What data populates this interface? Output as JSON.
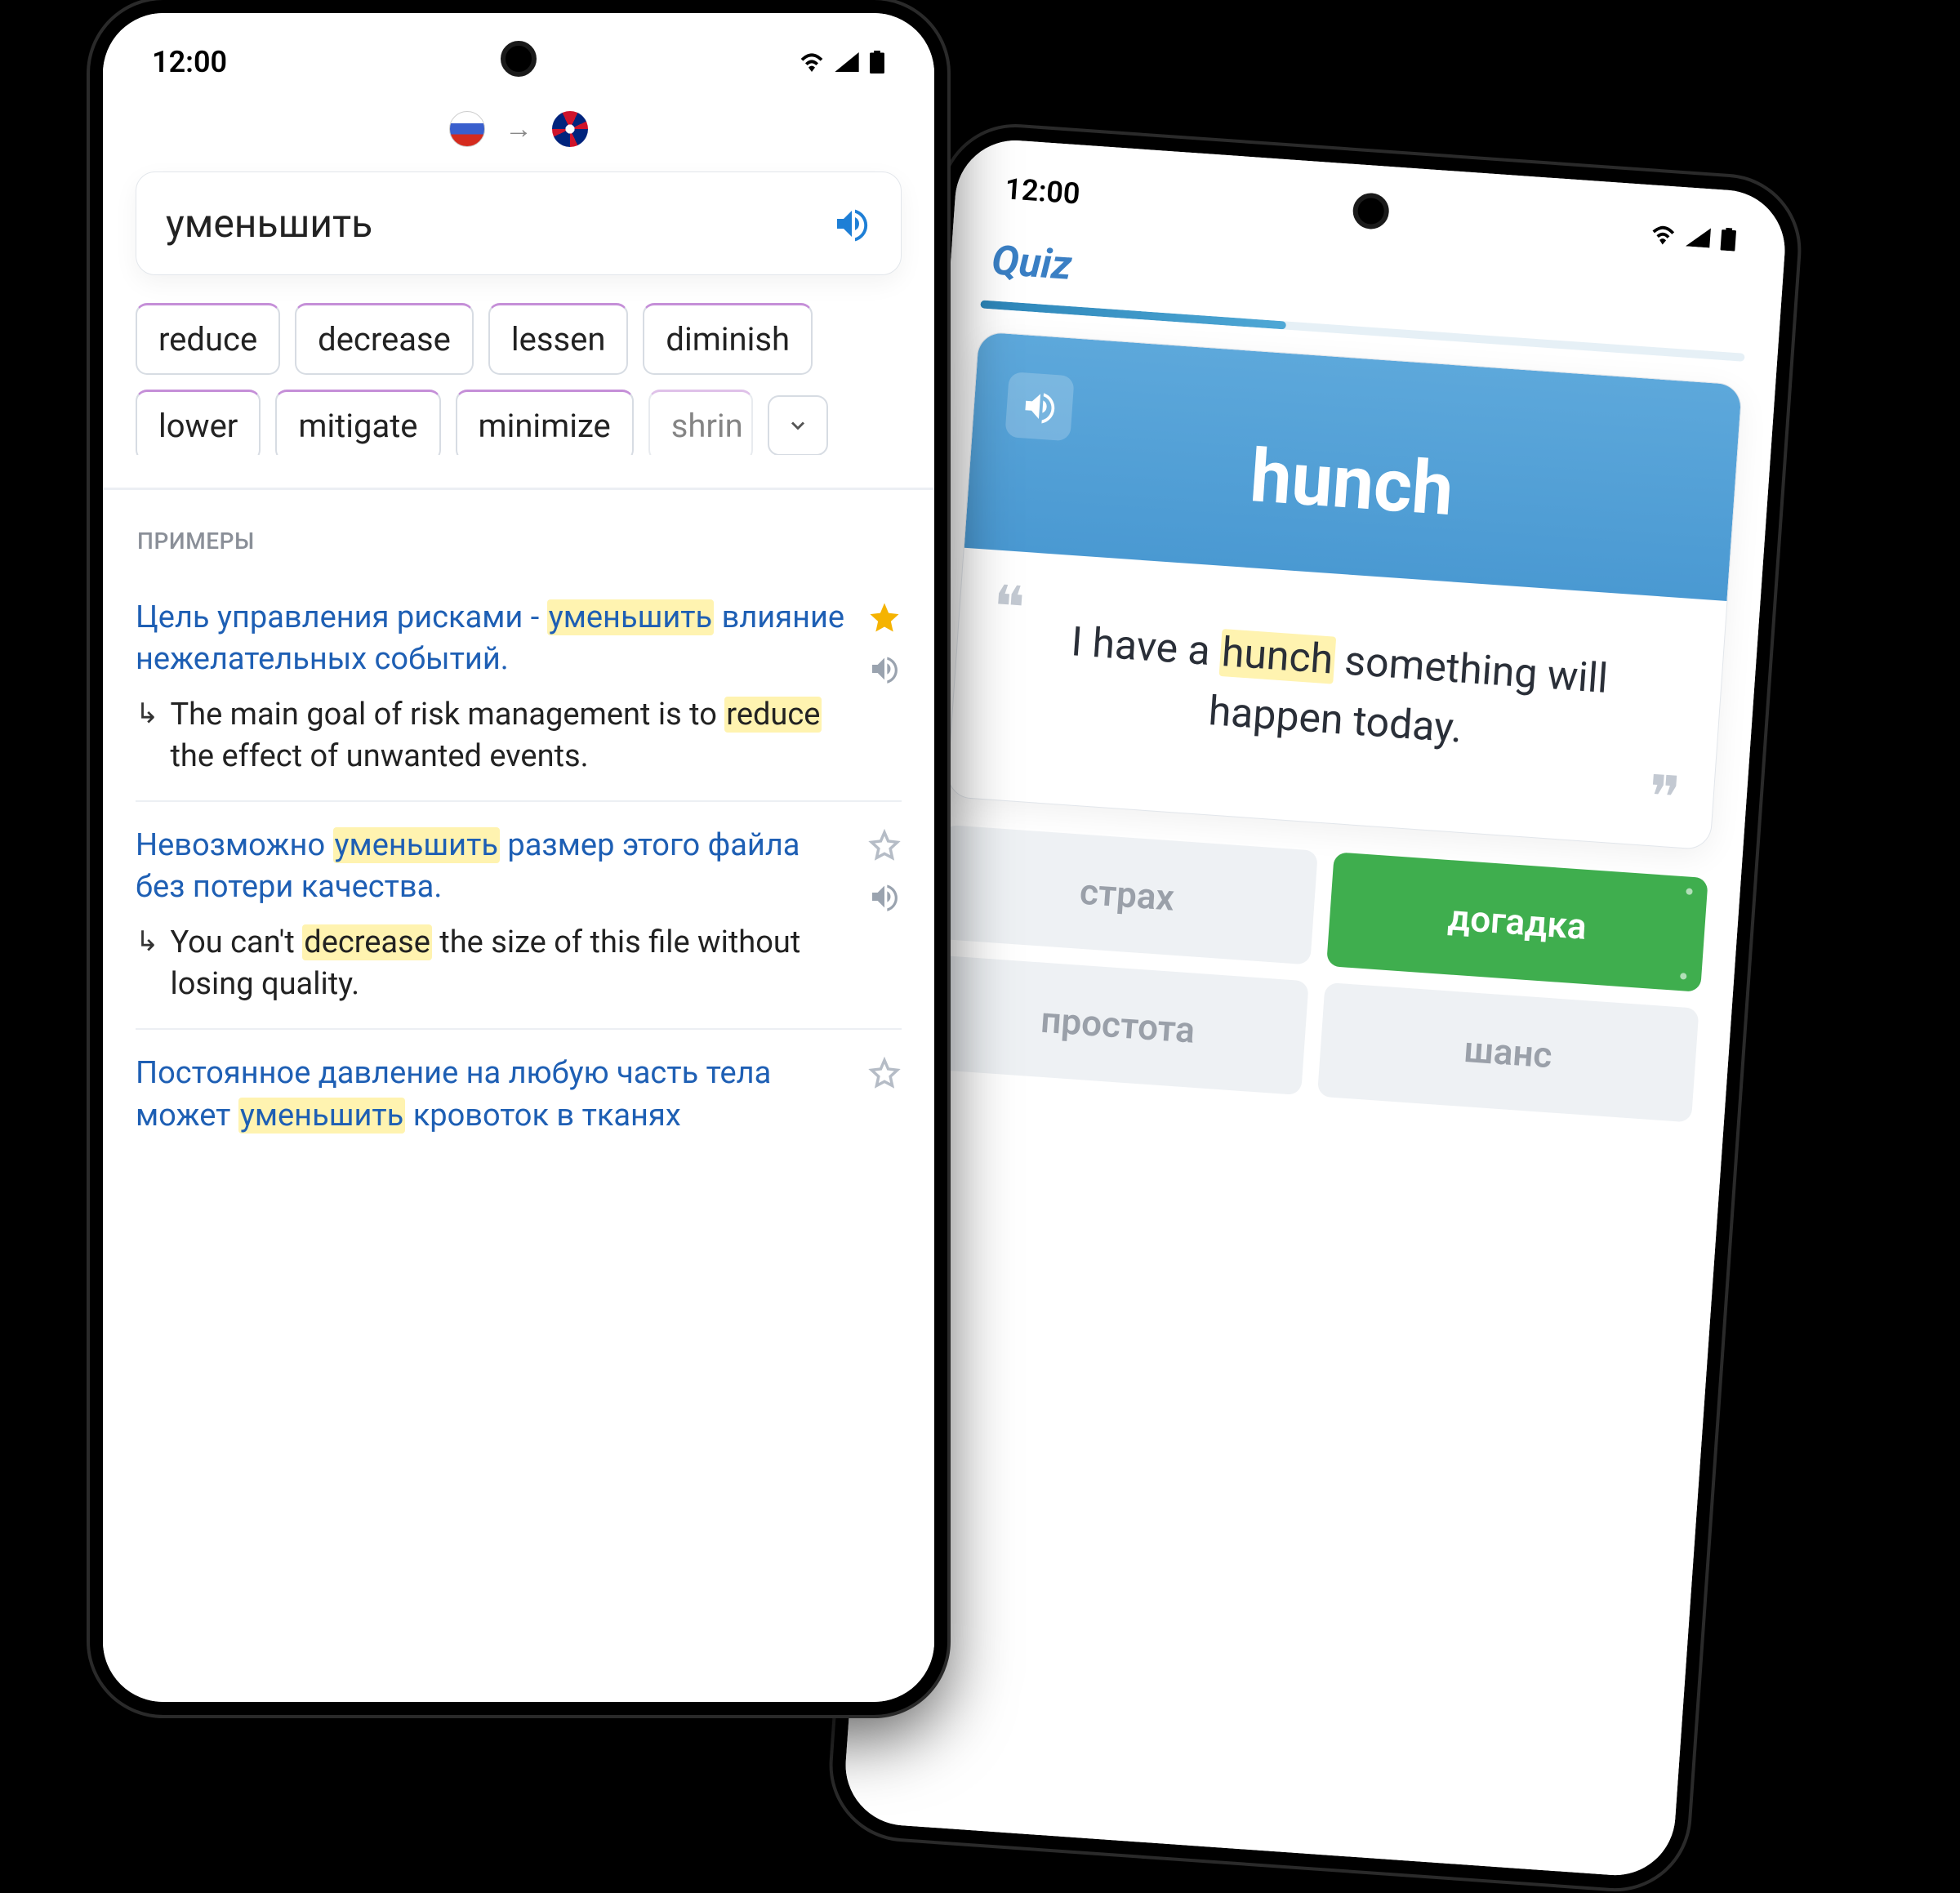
{
  "status": {
    "time": "12:00"
  },
  "phone1": {
    "lang": {
      "from": "ru",
      "to": "en"
    },
    "search_word": "уменьшить",
    "chips": [
      "reduce",
      "decrease",
      "lessen",
      "diminish",
      "lower",
      "mitigate",
      "minimize"
    ],
    "chip_fade": "shrin",
    "section_examples_label": "ПРИМЕРЫ",
    "examples": [
      {
        "ru_pre": "Цель управления рисками - ",
        "ru_hl": "уменьшить",
        "ru_post": " влияние нежелательных событий.",
        "en_pre": "The main goal of risk management is to ",
        "en_hl": "reduce",
        "en_post": " the effect of unwanted events.",
        "starred": true,
        "show_spk": true
      },
      {
        "ru_pre": "Невозможно ",
        "ru_hl": "уменьшить",
        "ru_post": " размер этого файла без потери качества.",
        "en_pre": "You can't ",
        "en_hl": "decrease",
        "en_post": " the size of this file without losing quality.",
        "starred": false,
        "show_spk": true
      },
      {
        "ru_pre": "Постоянное давление на любую часть тела может ",
        "ru_hl": "уменьшить",
        "ru_post": " кровоток в тканях",
        "en_pre": "",
        "en_hl": "",
        "en_post": "",
        "starred": false,
        "show_spk": false
      }
    ]
  },
  "phone2": {
    "title": "Quiz",
    "word": "hunch",
    "sentence_pre": "I have a ",
    "sentence_hl": "hunch",
    "sentence_post": " something will happen today.",
    "options": [
      {
        "label": "страх",
        "correct": false
      },
      {
        "label": "догадка",
        "correct": true
      },
      {
        "label": "простота",
        "correct": false
      },
      {
        "label": "шанс",
        "correct": false
      }
    ]
  }
}
